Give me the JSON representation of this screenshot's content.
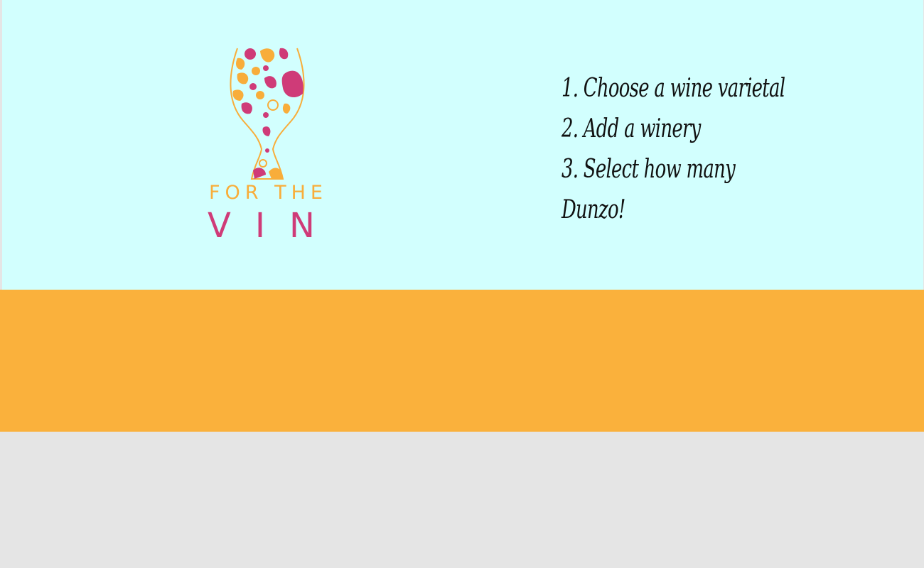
{
  "colors": {
    "hero_background": "#d2fffe",
    "band_orange": "#fab13c",
    "page_gray": "#e5e5e5",
    "brand_orange": "#f8ad3a",
    "brand_magenta": "#cf3b78"
  },
  "logo": {
    "icon": "wine-glass-floral-icon",
    "line1": "FOR THE",
    "line2": "VIN"
  },
  "steps": [
    "1. Choose a wine varietal",
    "2. Add a winery",
    "3. Select how many",
    "Dunzo!"
  ]
}
